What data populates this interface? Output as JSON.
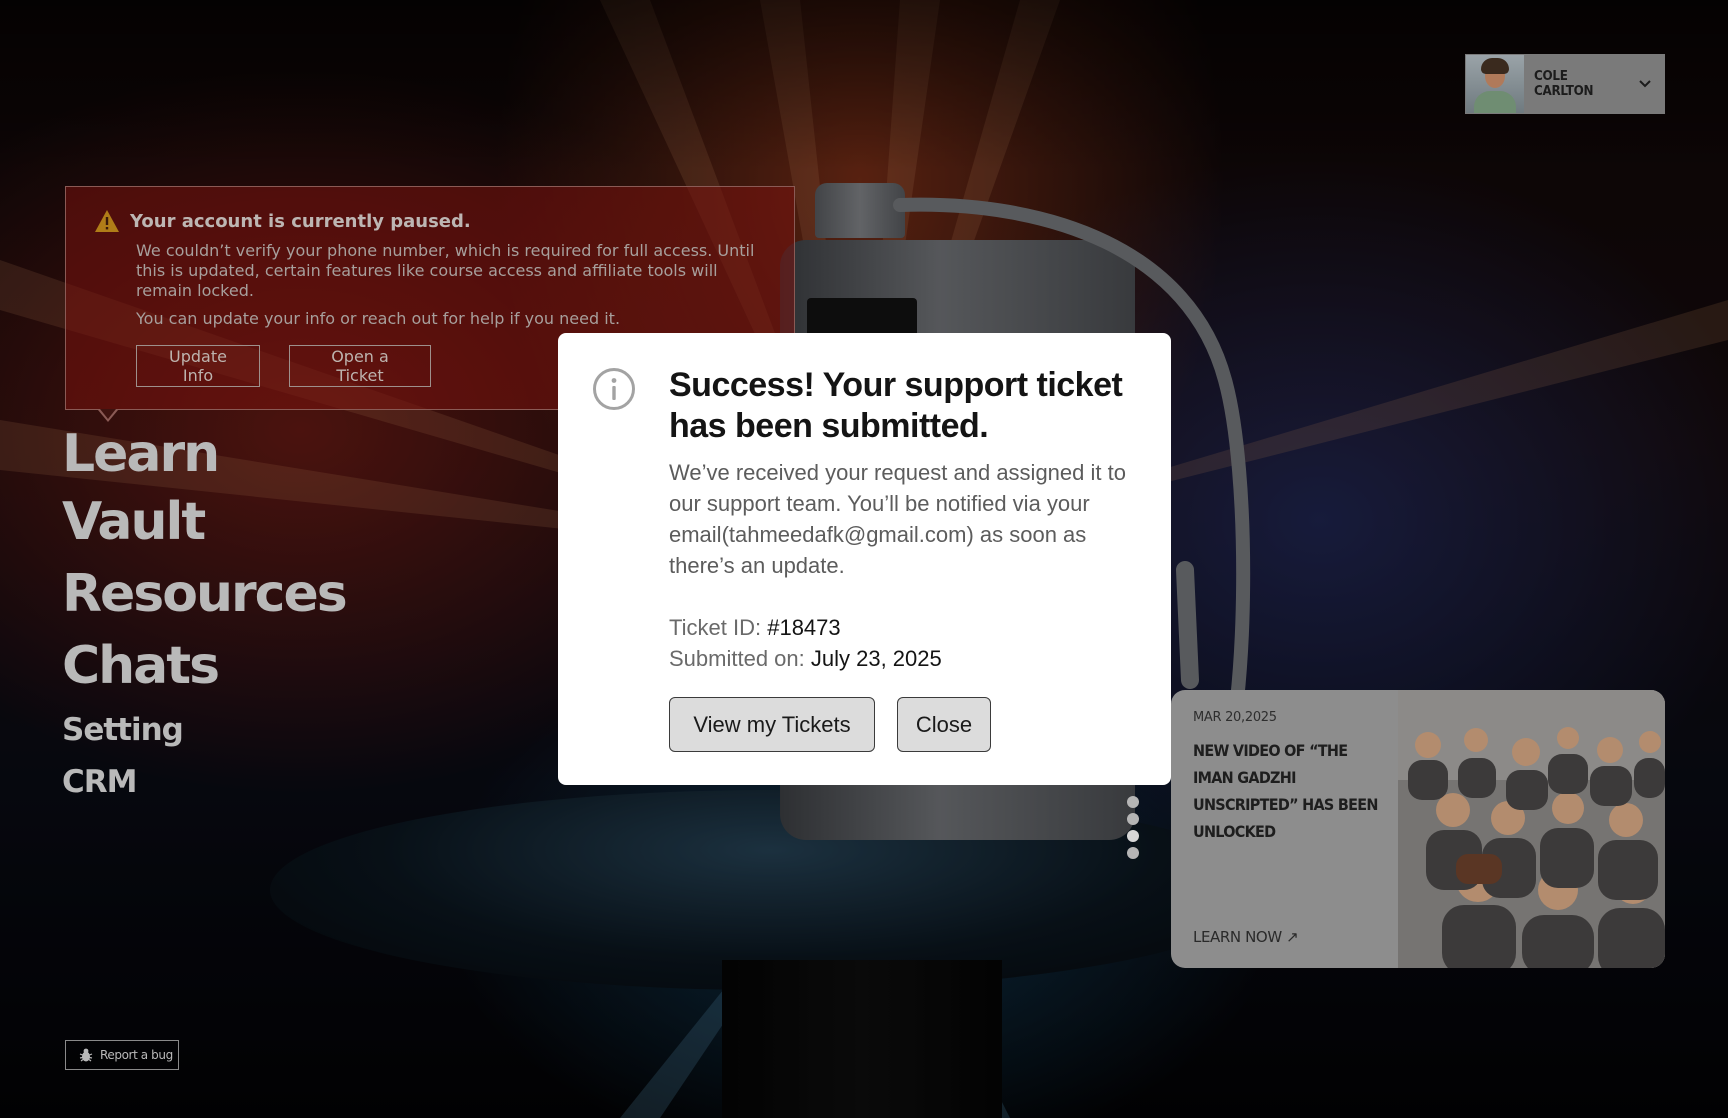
{
  "user": {
    "name": "COLE CARLTON"
  },
  "alert": {
    "title": "Your account is currently paused.",
    "body1": "We couldn’t verify your phone number, which is required for full access. Until this is updated, certain features like course access and affiliate tools will remain locked.",
    "body2": "You can update your info or reach out for help if you need it.",
    "update_label": "Update Info",
    "ticket_label": "Open a Ticket"
  },
  "nav": {
    "items": [
      {
        "label": "Learn"
      },
      {
        "label": "Vault"
      },
      {
        "label": "Resources"
      },
      {
        "label": "Chats"
      },
      {
        "label": "Setting"
      },
      {
        "label": "CRM"
      }
    ]
  },
  "report": {
    "label": "Report a bug"
  },
  "news": {
    "date": "MAR 20,2025",
    "title": "NEW VIDEO OF “THE IMAN GADZHI UNSCRIPTED” HAS BEEN UNLOCKED",
    "link": "LEARN NOW ↗"
  },
  "modal": {
    "title": "Success! Your support ticket has been submitted.",
    "body": "We’ve received your request and assigned it to our support team. You’ll be notified via your email(tahmeedafk@gmail.com) as soon as there’s an update.",
    "ticket_id_label": "Ticket ID:",
    "ticket_id": "#18473",
    "submitted_label": "Submitted on:",
    "submitted_date": "July 23, 2025",
    "view_label": "View my Tickets",
    "close_label": "Close"
  },
  "carousel": {
    "count": 4,
    "active": 2
  },
  "colors": {
    "alert_bg": "#78120e",
    "modal_bg": "#ffffff",
    "warning": "#e0a21b"
  }
}
